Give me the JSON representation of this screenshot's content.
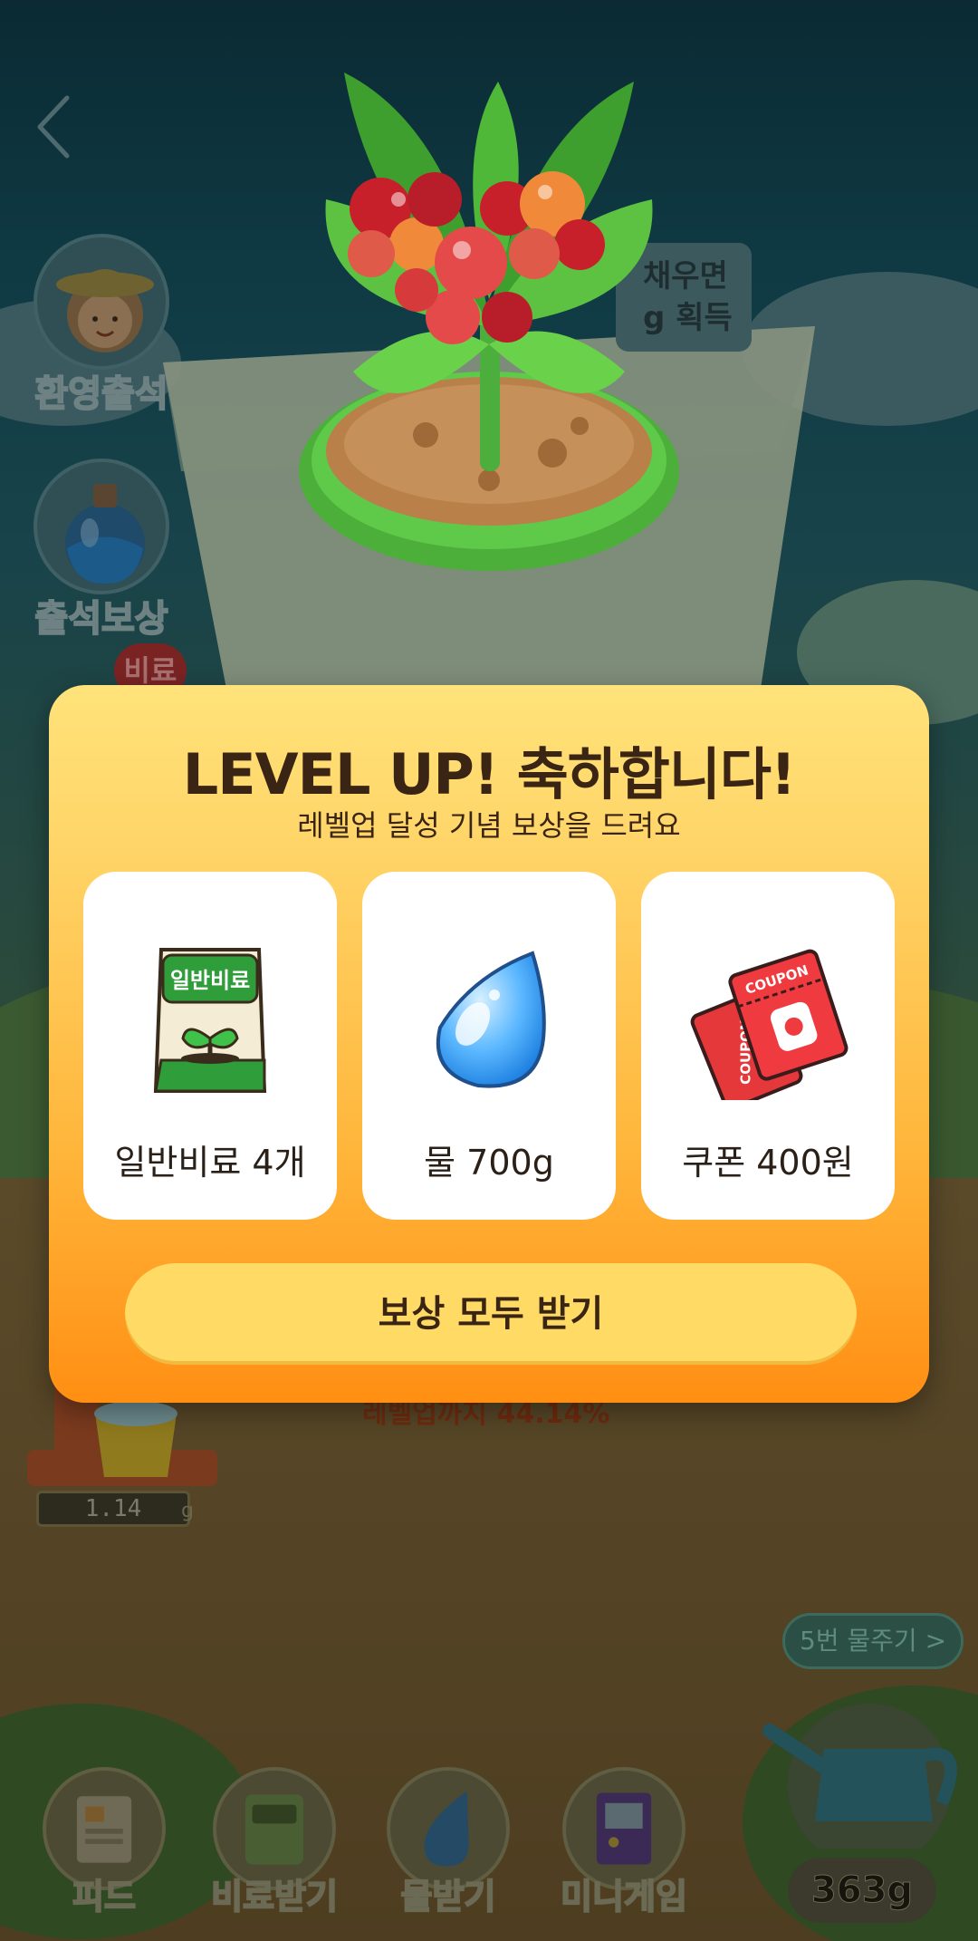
{
  "background": {
    "side_menu": [
      {
        "label": "환영출석",
        "icon": "farmer-girl-icon"
      },
      {
        "label": "출석보상",
        "icon": "potion-bottle-icon"
      }
    ],
    "badge": "비료",
    "tip_lines": [
      "채우면",
      "g 획득"
    ],
    "progress_text": "레벨업까지 44.14%",
    "meter_value": "1.14",
    "meter_unit": "g",
    "water_count_button": "5번 물주기 >",
    "water_amount": "363g",
    "bottom_nav": [
      {
        "label": "피드",
        "icon": "feed-icon"
      },
      {
        "label": "비료받기",
        "icon": "fertilizer-bag-icon"
      },
      {
        "label": "물받기",
        "icon": "water-drop-icon"
      },
      {
        "label": "미니게임",
        "icon": "arcade-icon"
      }
    ]
  },
  "modal": {
    "title": "LEVEL UP! 축하합니다!",
    "subtitle": "레벨업 달성 기념 보상을 드려요",
    "rewards": [
      {
        "label": "일반비료 4개",
        "icon": "fertilizer-bag-icon",
        "bag_text": "일반비료"
      },
      {
        "label": "물 700g",
        "icon": "water-drop-icon"
      },
      {
        "label": "쿠폰 400원",
        "icon": "coupon-icon",
        "coupon_text": "COUPON"
      }
    ],
    "claim_button": "보상 모두 받기"
  },
  "colors": {
    "modal_top": "#ffe37a",
    "modal_bottom": "#ff8f13",
    "button": "#ffdb66",
    "text_dark": "#3a2413"
  }
}
